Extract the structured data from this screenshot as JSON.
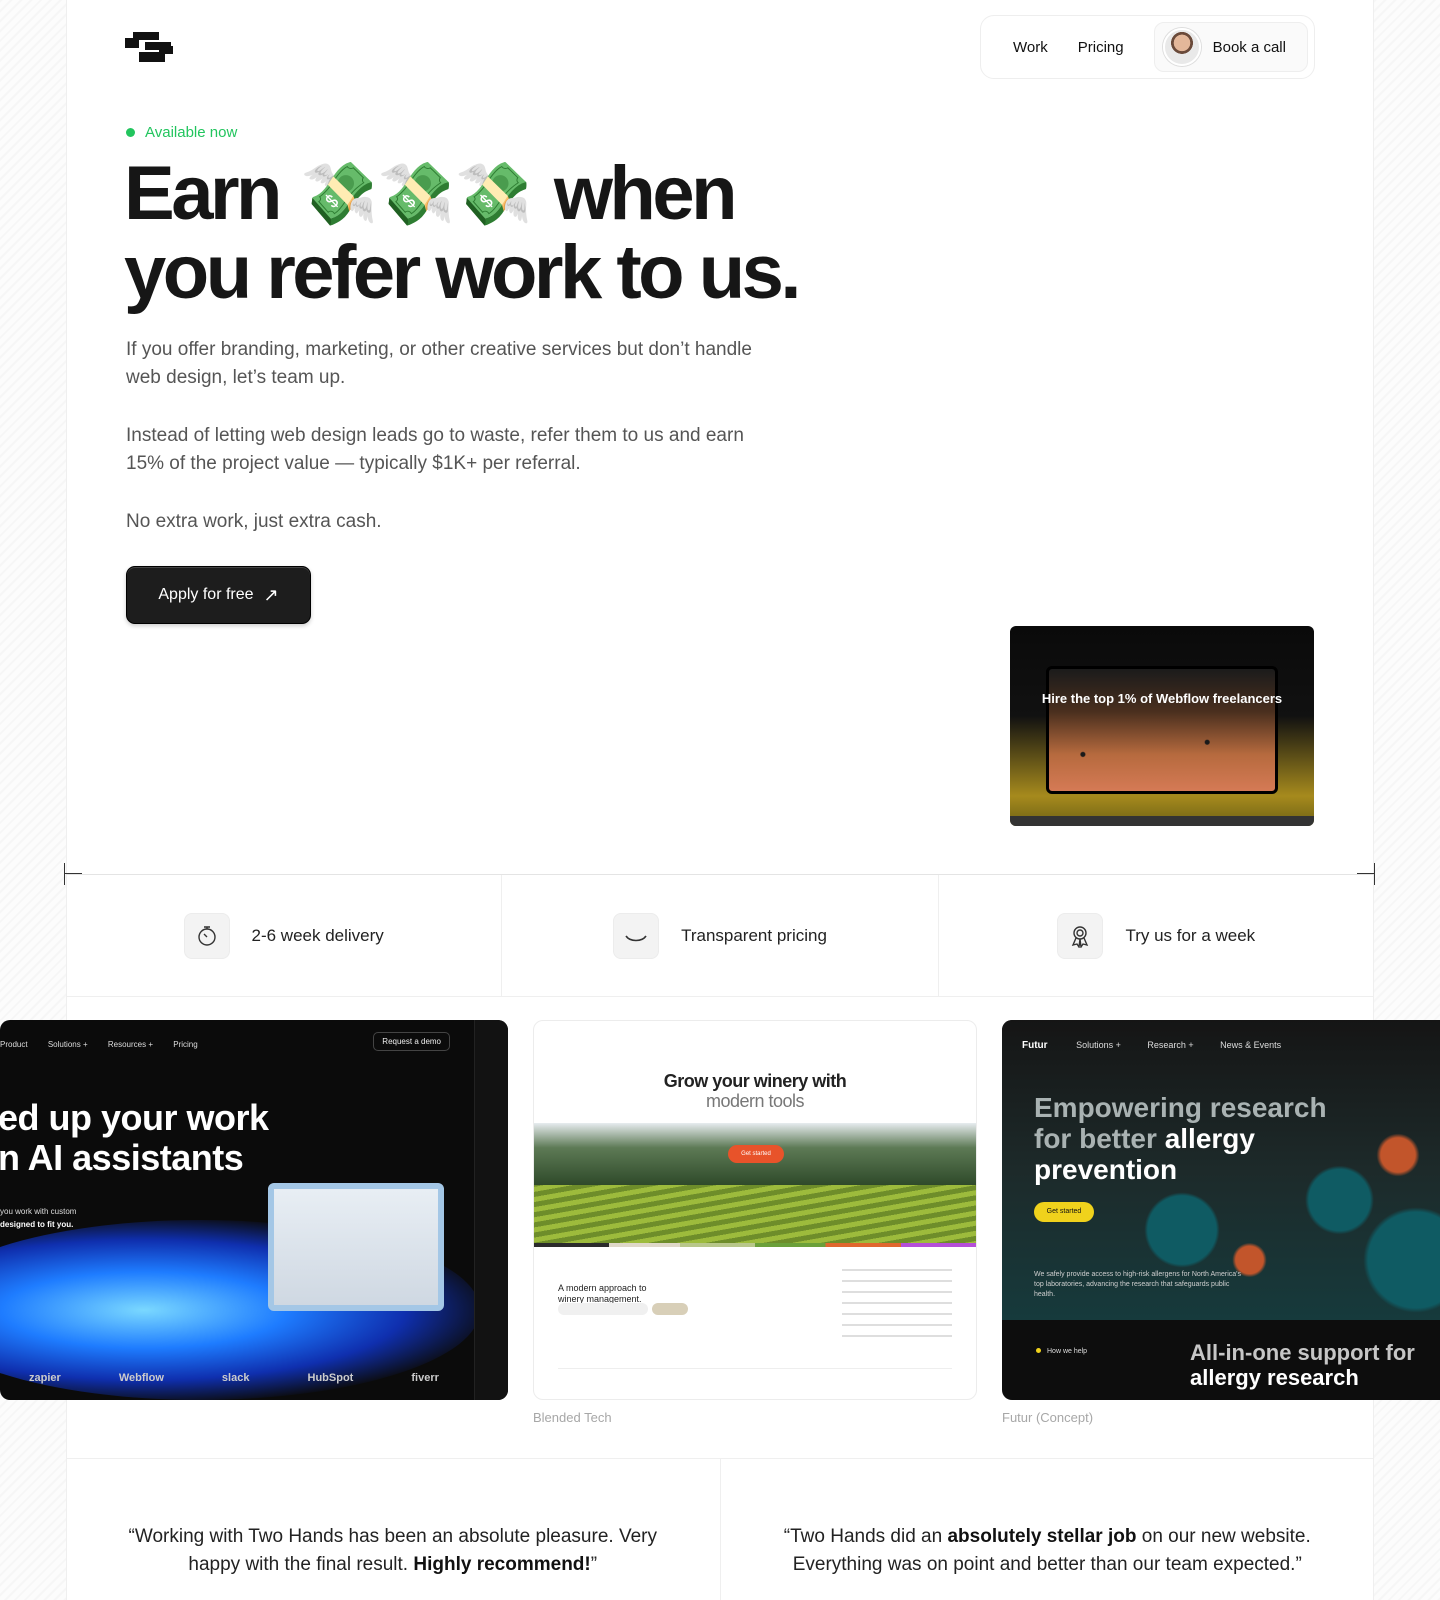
{
  "header": {
    "nav": [
      "Work",
      "Pricing"
    ],
    "book_label": "Book a call"
  },
  "hero": {
    "availability": "Available now",
    "title_word_1": "Earn",
    "emoji": "💸💸💸",
    "title_word_2": "when",
    "title_line_2": "you refer work to us.",
    "paragraphs": [
      "If you offer branding, marketing, or other creative services but don’t handle web design, let’s team up.",
      "Instead of letting web design leads go to waste, refer them to us and earn 15% of the project value — typically $1K+ per referral.",
      "No extra work, just extra cash."
    ],
    "cta_label": "Apply for free",
    "cta_icon": "arrow-up-right-icon"
  },
  "preview_small": {
    "title": "Hire the top 1% of Webflow freelancers"
  },
  "features": [
    {
      "icon": "stopwatch-icon",
      "label": "2-6 week delivery"
    },
    {
      "icon": "smile-icon",
      "label": "Transparent pricing"
    },
    {
      "icon": "award-icon",
      "label": "Try us for a week"
    }
  ],
  "portfolio": [
    {
      "nav": [
        "Product",
        "Solutions +",
        "Resources +",
        "Pricing"
      ],
      "button": "Request a demo",
      "headline_1": "ed up your work",
      "headline_2": "n AI assistants",
      "sub_1": "you work with custom",
      "sub_2": "designed to fit you.",
      "logos": [
        "zapier",
        "Webflow",
        "slack",
        "HubSpot",
        "fiverr"
      ],
      "caption": ""
    },
    {
      "title_1": "Grow your winery with",
      "title_2": "modern tools",
      "button": "Get started",
      "footer_text": "A modern approach to winery management.",
      "caption": "Blended Tech"
    },
    {
      "brand": "Futur",
      "nav": [
        "Solutions +",
        "Research +",
        "News & Events"
      ],
      "headline_1": "Empowering research",
      "headline_2a": "for better",
      "headline_2b": "allergy",
      "headline_3": "prevention",
      "button": "Get started",
      "body": "We safely provide access to high-risk allergens for North America's top laboratories, advancing the research that safeguards public health.",
      "help": "How we help",
      "bottom_1": "All-in-one support for",
      "bottom_2": "allergy research",
      "caption": "Futur (Concept)"
    }
  ],
  "testimonials": [
    {
      "before": "“Working with Two Hands has been an absolute pleasure. Very happy with the final result. ",
      "bold": "Highly recommend!",
      "after": "”"
    },
    {
      "before": "“Two Hands did an ",
      "bold": "absolutely stellar job",
      "after": " on our new website. Everything was on point and better than our team expected.”"
    }
  ]
}
